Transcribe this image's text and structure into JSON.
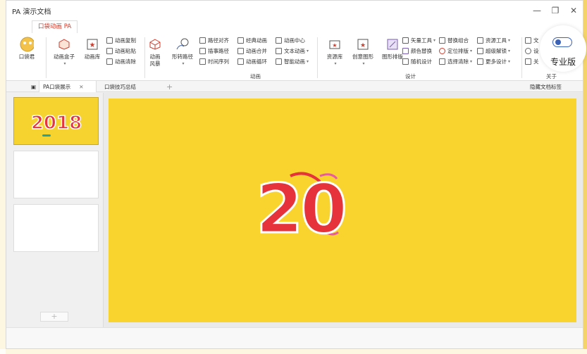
{
  "window": {
    "title": "PA 演示文档"
  },
  "ribbon_tab": "口袋动画 PA",
  "ribbon": {
    "pocket_btn": "口袋君",
    "anim_box": "动画盒子",
    "anim_lib": "动画库",
    "anim_copy": "动画复制",
    "anim_paste": "动画粘贴",
    "anim_clear": "动画清除",
    "anim_scene": "动画风暴",
    "shape_path": "形转路径",
    "path_align": "路径对齐",
    "snap_path": "插事路径",
    "timeline": "时间序列",
    "classic_anim": "经典动画",
    "anim_merge": "动画合并",
    "anim_loop": "动画循环",
    "anim_center": "动画中心",
    "text_anim": "文本动画",
    "smart_anim": "智能动画",
    "group_anim": "动画",
    "res_lib": "资源库",
    "creative_shape": "创意图形",
    "shape_layout": "图形排版",
    "vector_tool": "矢量工具",
    "color_replace": "颜色替换",
    "random_design": "随机设计",
    "replace_combo": "替换组合",
    "locate_sort": "定位排版",
    "select_clear": "选择清除",
    "res_tool": "资源工具",
    "super_unlock": "超级解锁",
    "more_design": "更多设计",
    "group_design": "设计",
    "about_1": "文",
    "about_2": "设",
    "about_3": "关",
    "group_about": "关于"
  },
  "doc_tabs": {
    "tab1": "PA口袋展示",
    "tab2": "口袋技巧总结",
    "add": "+",
    "hide_label": "隐藏文档标签"
  },
  "slide": {
    "thumb_text": "2018",
    "big_text": "20"
  },
  "pro_badge": "专业版",
  "add_slide": "+",
  "colors": {
    "slide_bg": "#f9d32e",
    "accent_red": "#d23a2a",
    "toggle_blue": "#3a63b8"
  }
}
